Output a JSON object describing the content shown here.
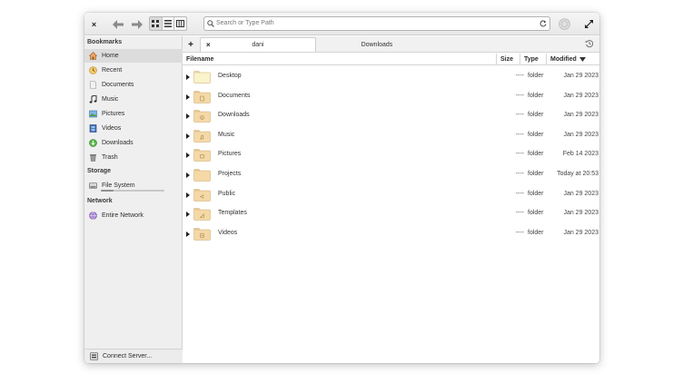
{
  "toolbar": {
    "close_label": "×",
    "search_placeholder": "Search or Type Path"
  },
  "sidebar": {
    "bookmarks_header": "Bookmarks",
    "bookmarks": [
      {
        "label": "Home",
        "icon": "home-icon",
        "selected": true
      },
      {
        "label": "Recent",
        "icon": "recent-icon"
      },
      {
        "label": "Documents",
        "icon": "documents-icon"
      },
      {
        "label": "Music",
        "icon": "music-icon"
      },
      {
        "label": "Pictures",
        "icon": "pictures-icon"
      },
      {
        "label": "Videos",
        "icon": "videos-icon"
      },
      {
        "label": "Downloads",
        "icon": "downloads-icon"
      },
      {
        "label": "Trash",
        "icon": "trash-icon"
      }
    ],
    "storage_header": "Storage",
    "storage": [
      {
        "label": "File System",
        "icon": "drive-icon",
        "used_fraction": 0.2
      }
    ],
    "network_header": "Network",
    "network": [
      {
        "label": "Entire Network",
        "icon": "network-icon"
      }
    ],
    "connect_server_label": "Connect Server..."
  },
  "tabs": {
    "add_label": "+",
    "close_label": "×",
    "items": [
      {
        "label": "dani",
        "active": true
      },
      {
        "label": "Downloads",
        "active": false
      }
    ]
  },
  "columns": {
    "filename": "Filename",
    "size": "Size",
    "type": "Type",
    "modified": "Modified"
  },
  "files": [
    {
      "name": "Desktop",
      "size": "----",
      "type": "folder",
      "modified": "Jan 29 2023",
      "emblem": "desktop"
    },
    {
      "name": "Documents",
      "size": "----",
      "type": "folder",
      "modified": "Jan 29 2023",
      "emblem": "document"
    },
    {
      "name": "Downloads",
      "size": "----",
      "type": "folder",
      "modified": "Jan 29 2023",
      "emblem": "download"
    },
    {
      "name": "Music",
      "size": "----",
      "type": "folder",
      "modified": "Jan 29 2023",
      "emblem": "music"
    },
    {
      "name": "Pictures",
      "size": "----",
      "type": "folder",
      "modified": "Feb 14 2023",
      "emblem": "picture"
    },
    {
      "name": "Projects",
      "size": "----",
      "type": "folder",
      "modified": "Today at 20:53",
      "emblem": "none"
    },
    {
      "name": "Public",
      "size": "----",
      "type": "folder",
      "modified": "Jan 29 2023",
      "emblem": "share"
    },
    {
      "name": "Templates",
      "size": "----",
      "type": "folder",
      "modified": "Jan 29 2023",
      "emblem": "template"
    },
    {
      "name": "Videos",
      "size": "----",
      "type": "folder",
      "modified": "Jan 29 2023",
      "emblem": "video"
    }
  ],
  "colors": {
    "folder_body": "#f4d9a6",
    "folder_desktop": "#fbf3c9",
    "selection": "#dcdcdc"
  }
}
